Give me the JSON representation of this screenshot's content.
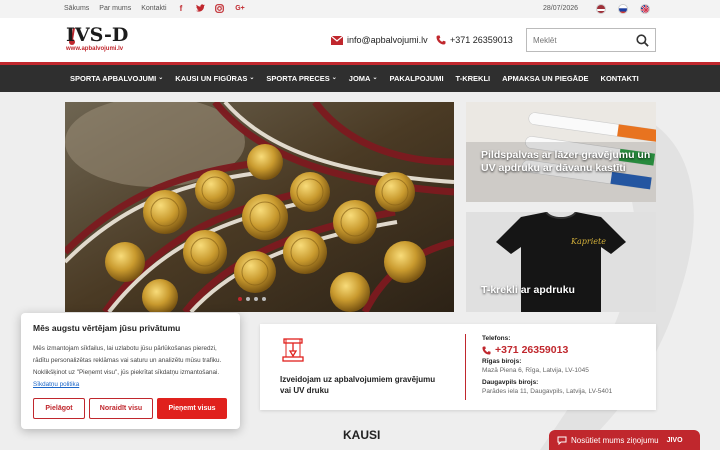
{
  "topbar": {
    "links": [
      "Sākums",
      "Par mums",
      "Kontakti"
    ],
    "social_icons": [
      "facebook-icon",
      "twitter-icon",
      "instagram-icon",
      "google-plus-icon"
    ],
    "date": "28/07/2026",
    "languages": [
      "latvian-flag-icon",
      "russian-flag-icon",
      "english-flag-icon"
    ]
  },
  "header": {
    "logo_text": "IVS-D",
    "logo_url": "www.apbalvojumi.lv",
    "email": "info@apbalvojumi.lv",
    "phone": "+371 26359013",
    "search_placeholder": "Meklēt"
  },
  "nav": {
    "items": [
      {
        "label": "SPORTA APBALVOJUMI",
        "dropdown": true
      },
      {
        "label": "KAUSI UN FIGŪRAS",
        "dropdown": true
      },
      {
        "label": "SPORTA PRECES",
        "dropdown": true
      },
      {
        "label": "JOMA",
        "dropdown": true
      },
      {
        "label": "PAKALPOJUMI",
        "dropdown": false
      },
      {
        "label": "T-KREKLI",
        "dropdown": false
      },
      {
        "label": "APMAKSA UN PIEGĀDE",
        "dropdown": false
      },
      {
        "label": "KONTAKTI",
        "dropdown": false
      }
    ]
  },
  "promos": [
    {
      "title": "Pildspalvas ar lāzer gravējumu un UV apdruku ar dāvanu kastīti"
    },
    {
      "title": "T-krekli ar apdruku"
    }
  ],
  "info": {
    "service_text": "Izveidojam uz apbalvojumiem gravējumu vai UV druku",
    "phone_label": "Telefons:",
    "phone": "+371 26359013",
    "riga_label": "Rīgas birojs:",
    "riga_address": "Mazā Piena 6, Rīga, Latvija, LV-1045",
    "daugavpils_label": "Daugavpils birojs:",
    "daugavpils_address": "Parādes iela 11, Daugavpils, Latvija, LV-5401"
  },
  "section_title": "KAUSI",
  "cookie": {
    "title": "Mēs augstu vērtējam jūsu privātumu",
    "text": "Mēs izmantojam sīkfailus, lai uzlabotu jūsu pārlūkošanas pieredzi, rādītu personalizētas reklāmas vai saturu un analizētu mūsu trafiku. Noklikšķinot uz \"Pieņemt visu\", jūs piekrītat sīkdatņu izmantošanai.",
    "policy_link": "Sīkdatņu politika",
    "btn_customize": "Pielāgot",
    "btn_reject": "Noraidīt visu",
    "btn_accept": "Pieņemt visus"
  },
  "chat": {
    "label": "Nosūtiet mums ziņojumu",
    "brand": "JIVO"
  },
  "colors": {
    "accent": "#c0272d",
    "nav_bg": "#2f2f2f",
    "accept_btn": "#e0211d"
  },
  "slider": {
    "slides": 4,
    "active": 1
  }
}
